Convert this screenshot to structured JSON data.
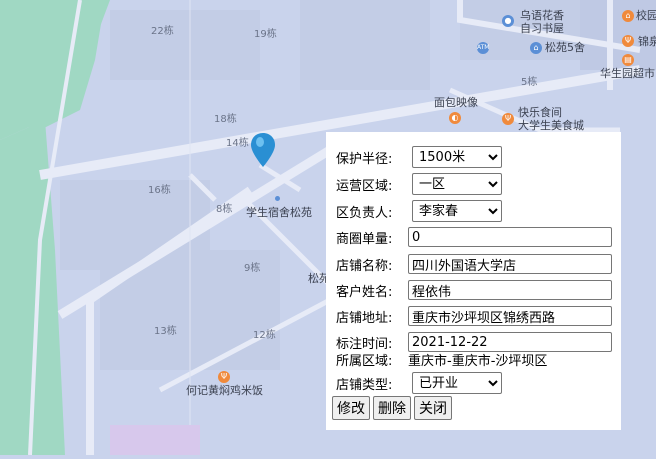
{
  "colors": {
    "map_bg": "#c9d3ec",
    "green_area": "#a0d8c3",
    "road": "#e7ebf7",
    "pin": "#2a8fd3",
    "poi_orange": "#f08a3c",
    "poi_blue": "#5b8fd6"
  },
  "map": {
    "block_labels": [
      "22栋",
      "19栋",
      "18栋",
      "14栋",
      "16栋",
      "8栋",
      "9栋",
      "13栋",
      "12栋",
      "5栋"
    ],
    "pois": [
      "乌语花香",
      "自习书屋",
      "松苑5舍",
      "校园",
      "锦泉",
      "华生园超市",
      "面包映像",
      "快乐食间",
      "大学生美食城",
      "学生宿舍松苑",
      "松苑",
      "何记黄焖鸡米饭"
    ],
    "icons": [
      "ATM"
    ]
  },
  "form": {
    "protect_radius": {
      "label": "保护半径:",
      "value": "1500米"
    },
    "operating_area": {
      "label": "运营区域:",
      "value": "一区"
    },
    "area_manager": {
      "label": "区负责人:",
      "value": "李家春"
    },
    "unit_price": {
      "label": "商圈单量:",
      "value": "0"
    },
    "shop_name": {
      "label": "店铺名称:",
      "value": "四川外国语大学店"
    },
    "customer_name": {
      "label": "客户姓名:",
      "value": "程依伟"
    },
    "shop_address": {
      "label": "店铺地址:",
      "value": "重庆市沙坪坝区锦绣西路"
    },
    "mark_time": {
      "label": "标注时间:",
      "value": "2021-12-22"
    },
    "region": {
      "label": "所属区域:",
      "value": "重庆市-重庆市-沙坪坝区"
    },
    "shop_type": {
      "label": "店铺类型:",
      "value": "已开业"
    },
    "buttons": {
      "edit": "修改",
      "delete": "删除",
      "close": "关闭"
    }
  }
}
